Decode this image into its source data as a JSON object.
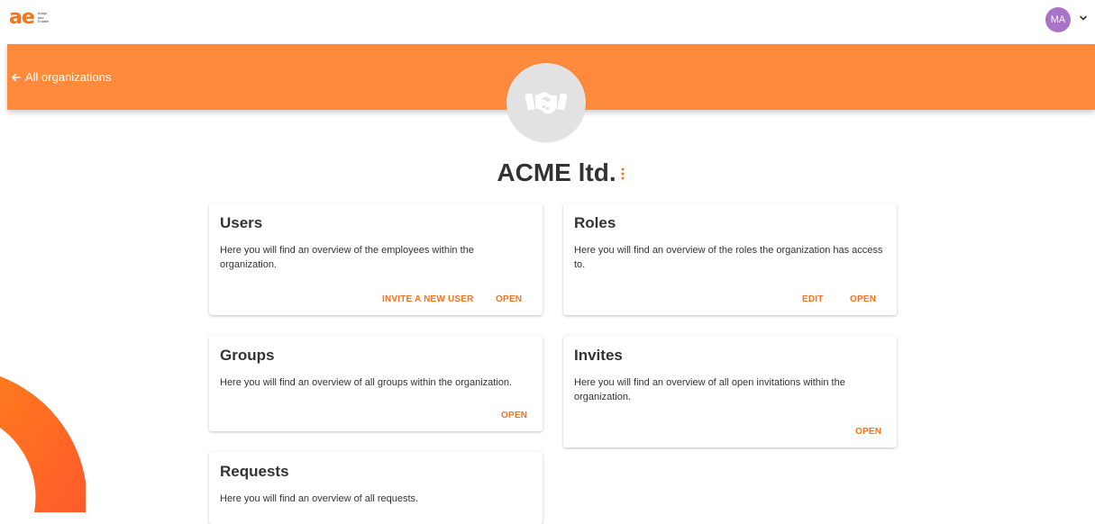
{
  "header": {
    "logo_text": "ae",
    "logo_tagline": [
      "Adapt",
      "and",
      "Enable"
    ],
    "avatar_initials": "MA"
  },
  "banner": {
    "back_label": "All organizations"
  },
  "organization": {
    "name": "ACME ltd.",
    "avatar_icon": "handshake-icon"
  },
  "cards": {
    "users": {
      "title": "Users",
      "description": "Here you will find an overview of the employees within the organization.",
      "actions": [
        "INVITE A NEW USER",
        "OPEN"
      ]
    },
    "roles": {
      "title": "Roles",
      "description": "Here you will find an overview of the roles the organization has access to.",
      "actions": [
        "EDIT",
        "OPEN"
      ]
    },
    "groups": {
      "title": "Groups",
      "description": "Here you will find an overview of all groups within the organization.",
      "actions": [
        "OPEN"
      ]
    },
    "invites": {
      "title": "Invites",
      "description": "Here you will find an overview of all open invitations within the organization.",
      "actions": [
        "OPEN"
      ]
    },
    "requests": {
      "title": "Requests",
      "description": "Here you will find an overview of all requests."
    }
  },
  "colors": {
    "brand_orange": "#f7731c",
    "banner_orange": "#ff8a3c",
    "avatar_purple": "#a974c8"
  }
}
